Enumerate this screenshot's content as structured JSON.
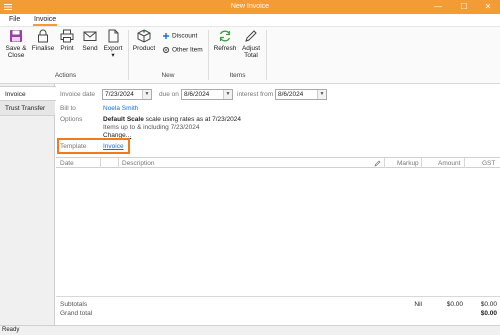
{
  "window": {
    "title": "New Invoice",
    "minimize": "—",
    "maximize": "☐",
    "close": "✕"
  },
  "menu": {
    "file": "File",
    "invoice": "Invoice"
  },
  "ribbon": {
    "save_close_1": "Save &",
    "save_close_2": "Close",
    "finalise": "Finalise",
    "print": "Print",
    "send": "Send",
    "export": "Export",
    "export_arrow": "▾",
    "group_actions": "Actions",
    "product": "Product",
    "discount": "Discount",
    "other_item": "Other Item",
    "group_new": "New",
    "refresh": "Refresh",
    "adjust_total_1": "Adjust",
    "adjust_total_2": "Total",
    "group_items": "Items"
  },
  "tabs": {
    "invoice": "Invoice",
    "trust_transfer": "Trust Transfer"
  },
  "form": {
    "invoice_date_label": "Invoice date",
    "invoice_date": "7/23/2024",
    "due_on_label": "due on",
    "due_on": "8/6/2024",
    "interest_from_label": "interest from",
    "interest_from": "8/6/2024",
    "bill_to_label": "Bill to",
    "bill_to": "Noela Smith",
    "options_label": "Options",
    "options_scale_bold": "Default Scale",
    "options_scale_rest": " scale using rates as at 7/23/2024",
    "options_items": "Items up to & including 7/23/2024",
    "options_change": "Change...",
    "template_label": "Template",
    "template_value": "Invoice"
  },
  "grid": {
    "headers": {
      "date": "Date",
      "description": "Description",
      "markup": "Markup",
      "amount": "Amount",
      "gst": "GST"
    }
  },
  "totals": {
    "subtotals_label": "Subtotals",
    "grand_total_label": "Grand total",
    "markup": "Nil",
    "amount": "$0.00",
    "gst": "$0.00",
    "grand_total": "$0.00"
  },
  "status": {
    "text": "Ready"
  }
}
